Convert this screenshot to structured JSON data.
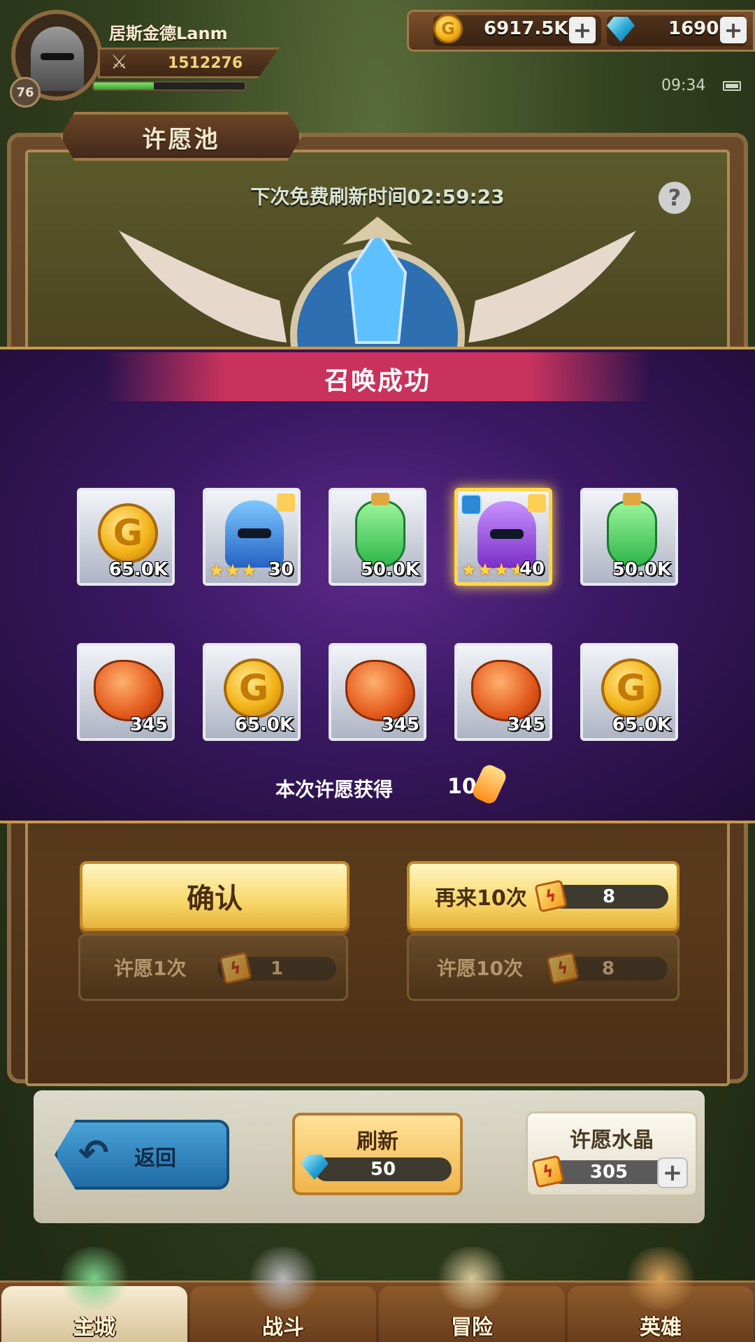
{
  "player": {
    "name": "居斯金德Lanm",
    "level": "76",
    "power": "1512276",
    "xp_fraction": 0.4
  },
  "resources": {
    "gold": "6917.5K",
    "gems": "1690"
  },
  "status": {
    "time": "09:34"
  },
  "panel": {
    "title": "许愿池",
    "refresh_timer": "下次免费刷新时间02:59:23",
    "help": "?"
  },
  "result": {
    "title": "召唤成功",
    "rewards": [
      {
        "type": "gold-coin",
        "qty": "65.0K"
      },
      {
        "type": "blue-helmet",
        "qty": "30",
        "stars": 3
      },
      {
        "type": "green-potion",
        "qty": "50.0K"
      },
      {
        "type": "purple-helmet",
        "qty": "40",
        "stars": 4,
        "highlight": true
      },
      {
        "type": "green-potion",
        "qty": "50.0K"
      },
      {
        "type": "orange-ore",
        "qty": "345"
      },
      {
        "type": "gold-coin",
        "qty": "65.0K"
      },
      {
        "type": "orange-ore",
        "qty": "345"
      },
      {
        "type": "orange-ore",
        "qty": "345"
      },
      {
        "type": "gold-coin",
        "qty": "65.0K"
      }
    ],
    "wish_gain_label": "本次许愿获得",
    "wish_gain_count": "10"
  },
  "buttons": {
    "confirm": "确认",
    "again_label": "再来10次",
    "again_cost": "8",
    "wish1_label": "许愿1次",
    "wish1_cost": "1",
    "wish10_label": "许愿10次",
    "wish10_cost": "8"
  },
  "bottom": {
    "back": "返回",
    "refresh_label": "刷新",
    "refresh_cost": "50",
    "wish_crystal_label": "许愿水晶",
    "wish_crystal_count": "305"
  },
  "nav": [
    {
      "label": "主城",
      "active": true
    },
    {
      "label": "战斗",
      "active": false
    },
    {
      "label": "冒险",
      "active": false
    },
    {
      "label": "英雄",
      "active": false
    }
  ],
  "colors": {
    "gold_accent": "#f7d76a",
    "banner_red": "#c8325c",
    "reward_band": "#3a1862"
  }
}
